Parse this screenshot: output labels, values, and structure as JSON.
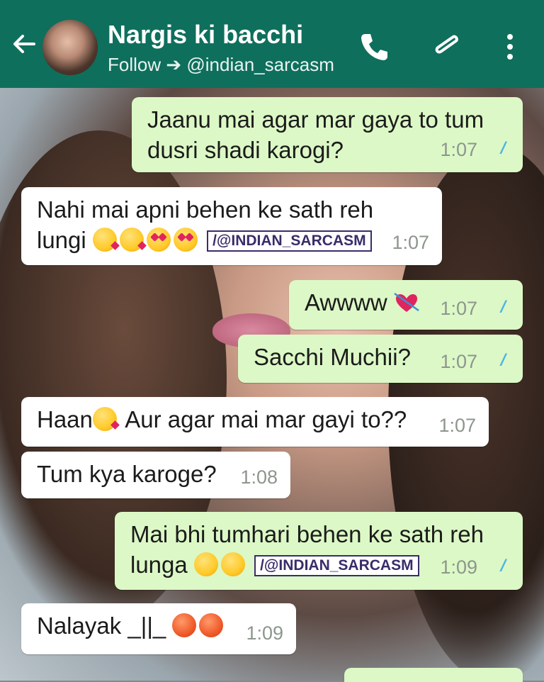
{
  "header": {
    "contact_name": "Nargis ki bacchi",
    "subtitle": "Follow ➔ @indian_sarcasm"
  },
  "stamp_text": "/@INDIAN_SARCASM",
  "messages": [
    {
      "dir": "out",
      "text": "Jaanu mai agar mar gaya to tum dusri shadi karogi?",
      "time": "1:07"
    },
    {
      "dir": "in",
      "text": "Nahi mai apni behen ke sath reh lungi",
      "time": "1:07"
    },
    {
      "dir": "out",
      "text": "Awwww",
      "time": "1:07"
    },
    {
      "dir": "out",
      "text": "Sacchi Muchii?",
      "time": "1:07"
    },
    {
      "dir": "in",
      "text_a": "Haan",
      "text_b": "Aur agar mai mar gayi to??",
      "time": "1:07"
    },
    {
      "dir": "in",
      "text": "Tum kya karoge?",
      "time": "1:08"
    },
    {
      "dir": "out",
      "text_a": "Mai bhi tumhari behen ke sath reh",
      "text_b": "lunga",
      "time": "1:09"
    },
    {
      "dir": "in",
      "text": "Nalayak _||_",
      "time": "1:09"
    }
  ],
  "colors": {
    "header": "#0e6f5c",
    "outgoing": "#dcf8c6",
    "incoming": "#ffffff",
    "read_ticks": "#4fb3e8"
  }
}
